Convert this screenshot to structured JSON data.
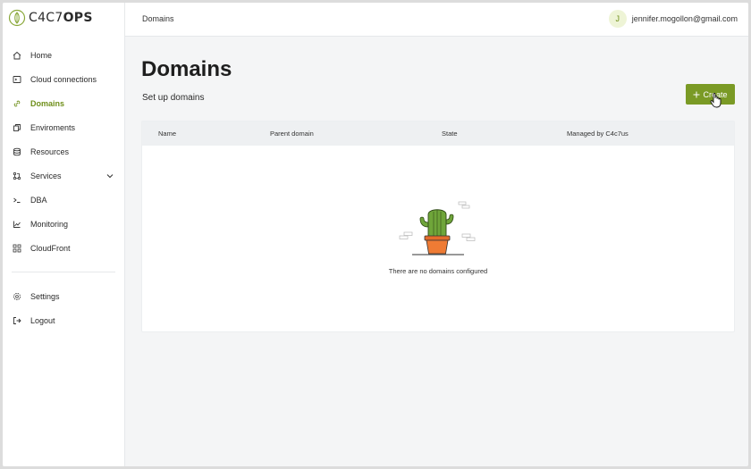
{
  "brand": {
    "logo_text_light": "C4C7",
    "logo_text_bold": "OPS",
    "accent": "#7a9a25"
  },
  "topbar": {
    "breadcrumb": "Domains",
    "user_initial": "J",
    "user_email": "jennifer.mogollon@gmail.com"
  },
  "sidebar": {
    "items": [
      {
        "label": "Home",
        "icon": "home-icon"
      },
      {
        "label": "Cloud connections",
        "icon": "cloud-connections-icon"
      },
      {
        "label": "Domains",
        "icon": "link-icon",
        "active": true
      },
      {
        "label": "Enviroments",
        "icon": "environments-icon"
      },
      {
        "label": "Resources",
        "icon": "database-icon"
      },
      {
        "label": "Services",
        "icon": "services-icon",
        "expandable": true
      },
      {
        "label": "DBA",
        "icon": "terminal-icon"
      },
      {
        "label": "Monitoring",
        "icon": "chart-icon"
      },
      {
        "label": "CloudFront",
        "icon": "cloudfront-icon"
      }
    ],
    "footer_items": [
      {
        "label": "Settings",
        "icon": "gear-icon"
      },
      {
        "label": "Logout",
        "icon": "logout-icon"
      }
    ]
  },
  "main": {
    "title": "Domains",
    "subtitle": "Set up domains",
    "create_label": "Create",
    "table": {
      "columns": [
        "Name",
        "Parent domain",
        "State",
        "Managed by C4c7us"
      ],
      "empty_message": "There are no domains configured"
    }
  }
}
